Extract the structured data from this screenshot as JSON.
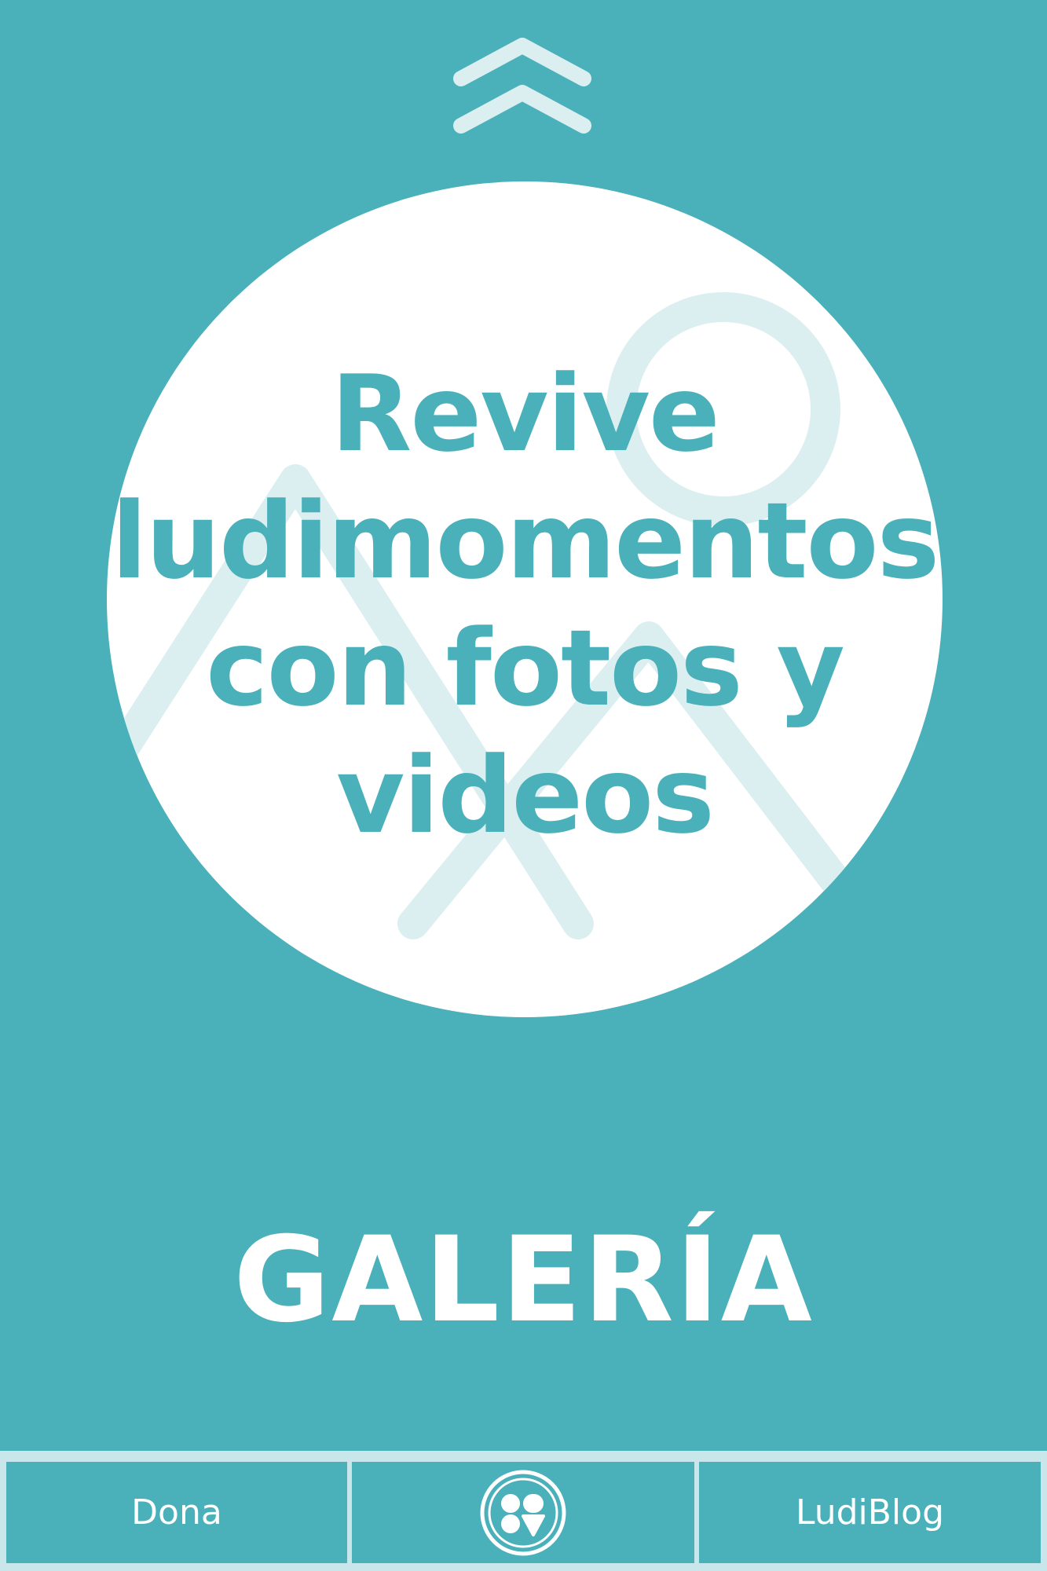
{
  "colors": {
    "background": "#4ab0ba",
    "circle": "#ffffff",
    "accent_light": "#dbeff1",
    "nav_border": "#c9e6ea"
  },
  "scroll_up": {
    "icon": "double-chevron-up-icon"
  },
  "hero": {
    "icon": "image-placeholder-icon",
    "headline_lines": [
      "Revive",
      "ludimomentos",
      "con fotos y",
      "videos"
    ]
  },
  "section": {
    "title": "GALERÍA"
  },
  "bottom_nav": {
    "left_label": "Dona",
    "center_icon": "ludi-logo-icon",
    "right_label": "LudiBlog"
  }
}
